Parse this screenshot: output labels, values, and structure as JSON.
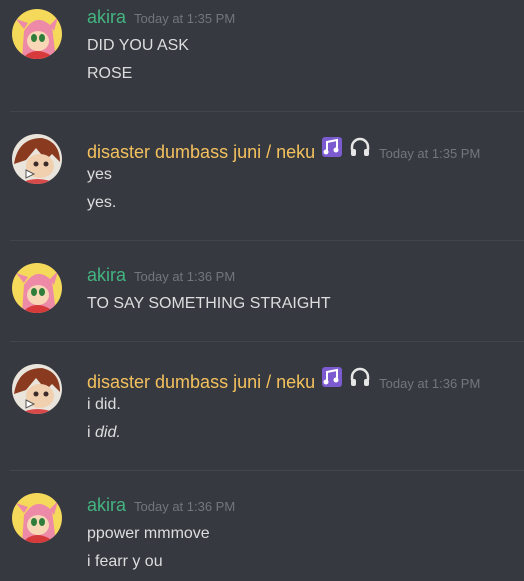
{
  "colors": {
    "background": "#36393f",
    "akira_name": "#43b581",
    "neku_name": "#f4c15e",
    "text": "#dcddde",
    "timestamp": "#72767d"
  },
  "messages": [
    {
      "author": "akira",
      "avatar_icon": "pink-hedgehog-avatar",
      "time": "Today at 1:35 PM",
      "lines": [
        "DID YOU ASK",
        "ROSE"
      ]
    },
    {
      "author": "disaster dumbass juni / neku",
      "avatar_icon": "brown-haired-character-avatar",
      "badges": [
        "music-notes-icon",
        "headphones-icon"
      ],
      "time": "Today at 1:35 PM",
      "lines": [
        "yes",
        "yes."
      ]
    },
    {
      "author": "akira",
      "avatar_icon": "pink-hedgehog-avatar",
      "time": "Today at 1:36 PM",
      "lines": [
        "TO SAY SOMETHING STRAIGHT"
      ]
    },
    {
      "author": "disaster dumbass juni / neku",
      "avatar_icon": "brown-haired-character-avatar",
      "badges": [
        "music-notes-icon",
        "headphones-icon"
      ],
      "time": "Today at 1:36 PM",
      "lines": [
        "i did.",
        "i did."
      ],
      "italic_word": "did."
    },
    {
      "author": "akira",
      "avatar_icon": "pink-hedgehog-avatar",
      "time": "Today at 1:36 PM",
      "lines": [
        "ppower mmmove",
        "i fearr y ou"
      ]
    }
  ]
}
